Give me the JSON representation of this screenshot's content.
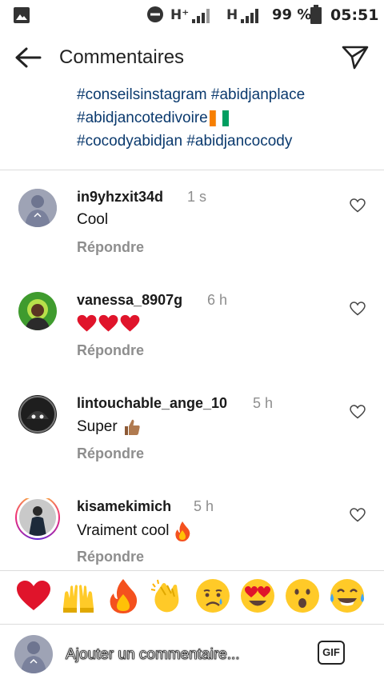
{
  "status_bar": {
    "network_1": "H⁺",
    "network_2": "H",
    "battery": "99 %",
    "time": "05:51"
  },
  "header": {
    "title": "Commentaires"
  },
  "caption": {
    "lines": [
      "#conseilsinstagram #abidjanplace",
      "#abidjancotedivoire",
      "#cocodyabidjan #abidjancocody"
    ]
  },
  "comments": [
    {
      "username": "in9yhzxit34d",
      "time": "1 s",
      "text": "Cool",
      "emoji": "",
      "reply": "Répondre"
    },
    {
      "username": "vanessa_8907g",
      "time": "6 h",
      "text": "",
      "emoji": "hearts-x3",
      "reply": "Répondre"
    },
    {
      "username": "lintouchable_ange_10",
      "time": "5 h",
      "text": "Super",
      "emoji": "thumbs-up",
      "reply": "Répondre"
    },
    {
      "username": "kisamekimich",
      "time": "5 h",
      "text": "Vraiment cool",
      "emoji": "fire",
      "reply": "Répondre"
    }
  ],
  "quick_reactions": [
    "red-heart",
    "raising-hands",
    "fire",
    "clapping-hands",
    "crying-face",
    "heart-eyes-face",
    "astonished-face",
    "tears-of-joy-face"
  ],
  "composer": {
    "placeholder": "Ajouter un commentaire...",
    "gif_label": "GIF"
  },
  "colors": {
    "hashtag": "#0b3a6e",
    "muted": "#8e8e8e",
    "heart_red": "#e0142b"
  }
}
